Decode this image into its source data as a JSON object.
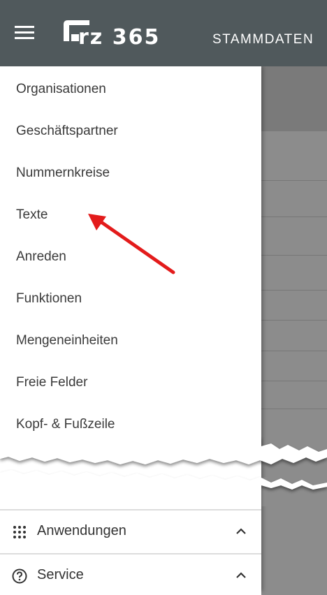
{
  "appbar": {
    "logo_text": "rz 365",
    "section_title": "STAMMDATEN",
    "menu_icon": "hamburger-icon"
  },
  "drawer": {
    "items": [
      {
        "label": "Organisationen"
      },
      {
        "label": "Geschäftspartner"
      },
      {
        "label": "Nummernkreise"
      },
      {
        "label": "Texte"
      },
      {
        "label": "Anreden"
      },
      {
        "label": "Funktionen"
      },
      {
        "label": "Mengeneinheiten"
      },
      {
        "label": "Freie Felder"
      },
      {
        "label": "Kopf- & Fußzeile"
      }
    ],
    "footer": [
      {
        "label": "Anwendungen",
        "icon": "apps-grid-icon"
      },
      {
        "label": "Service",
        "icon": "help-circle-icon"
      }
    ]
  },
  "annotation": {
    "arrow_color": "#e31b1b"
  },
  "colors": {
    "appbar": "#50595c",
    "overlay": "#8c8c8c"
  }
}
